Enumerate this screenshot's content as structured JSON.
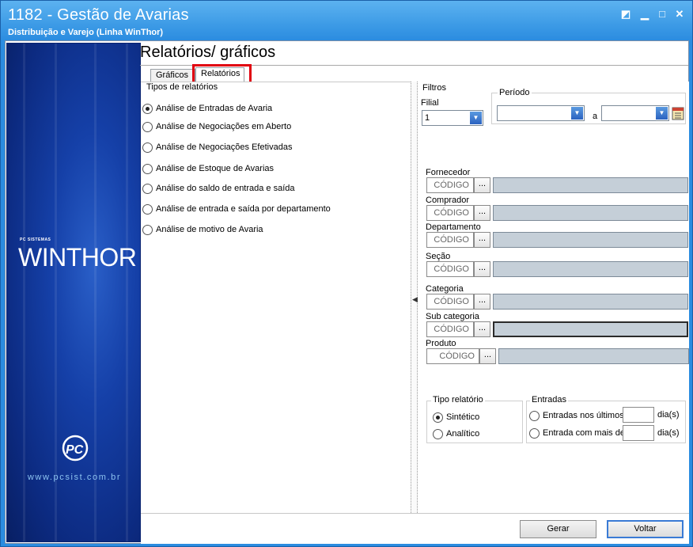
{
  "window": {
    "title": "1182 - Gestão de Avarias",
    "subtitle": "Distribuição e Varejo (Linha WinThor)",
    "controls": {
      "restore": "◩",
      "minimize": "▁",
      "maximize": "□",
      "close": "✕"
    }
  },
  "banner": {
    "brand_small": "PC SISTEMAS",
    "brand": "WINTHOR",
    "pc_logo": "PC",
    "website": "www.pcsist.com.br"
  },
  "page": {
    "title": "Relatórios/ gráficos"
  },
  "tabs": [
    {
      "label": "Gráficos",
      "active": false
    },
    {
      "label": "Relatórios",
      "active": true
    }
  ],
  "report_types": {
    "legend": "Tipos de relatórios",
    "options": [
      {
        "label": "Análise de Entradas de Avaria",
        "selected": true
      },
      {
        "label": "Análise de Negociações em Aberto",
        "selected": false
      },
      {
        "label": "Análise de Negociações Efetivadas",
        "selected": false
      },
      {
        "label": "Análise de Estoque de Avarias",
        "selected": false
      },
      {
        "label": "Análise do saldo de entrada e saída",
        "selected": false
      },
      {
        "label": "Análise de entrada e saída por departamento",
        "selected": false
      },
      {
        "label": "Análise de motivo de Avaria",
        "selected": false
      }
    ]
  },
  "filters": {
    "legend": "Filtros",
    "filial": {
      "label": "Filial",
      "value": "1"
    },
    "periodo": {
      "label": "Período",
      "separator": "a",
      "start": "",
      "end": ""
    },
    "code_placeholder": "CÓDIGO",
    "ellipsis": "...",
    "fields": [
      {
        "label": "Fornecedor"
      },
      {
        "label": "Comprador"
      },
      {
        "label": "Departamento"
      },
      {
        "label": "Seção"
      },
      {
        "label": "Categoria"
      },
      {
        "label": "Sub categoria"
      },
      {
        "label": "Produto"
      }
    ]
  },
  "tipo_relatorio": {
    "legend": "Tipo relatório",
    "options": [
      {
        "label": "Sintético",
        "selected": true
      },
      {
        "label": "Analítico",
        "selected": false
      }
    ]
  },
  "entradas": {
    "legend": "Entradas",
    "options": [
      {
        "label": "Entradas nos últimos",
        "unit": "dia(s)",
        "value": ""
      },
      {
        "label": "Entrada com mais de",
        "unit": "dia(s)",
        "value": ""
      }
    ]
  },
  "buttons": {
    "gerar": "Gerar",
    "voltar": "Voltar"
  },
  "colors": {
    "title_bar": "#3d9be6",
    "banner": "#1540a8",
    "highlight": "#e0000f"
  }
}
